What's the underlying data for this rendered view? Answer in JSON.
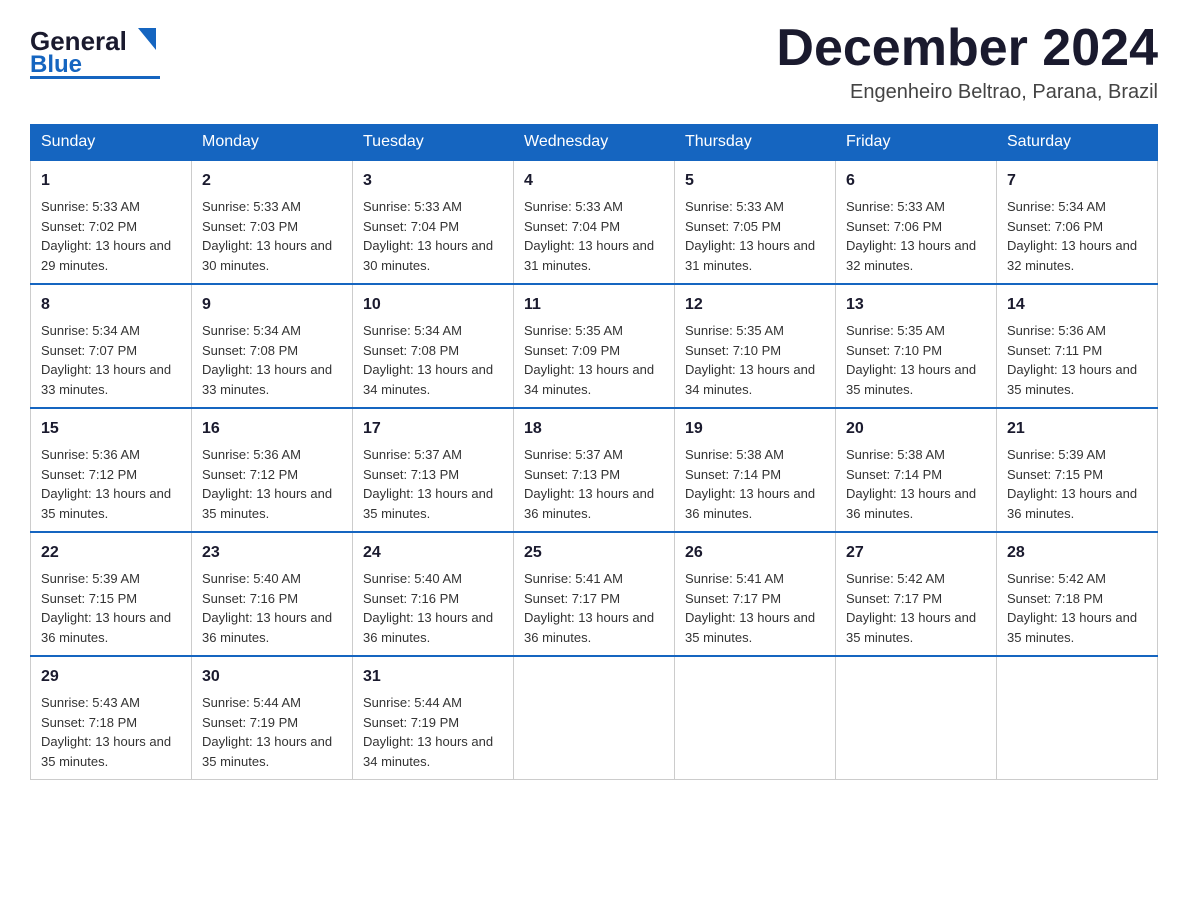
{
  "header": {
    "logo": {
      "line1": "General",
      "triangle": "▶",
      "line2": "Blue"
    },
    "title": "December 2024",
    "location": "Engenheiro Beltrao, Parana, Brazil"
  },
  "calendar": {
    "weekdays": [
      "Sunday",
      "Monday",
      "Tuesday",
      "Wednesday",
      "Thursday",
      "Friday",
      "Saturday"
    ],
    "weeks": [
      [
        {
          "day": "1",
          "sunrise": "5:33 AM",
          "sunset": "7:02 PM",
          "daylight": "13 hours and 29 minutes."
        },
        {
          "day": "2",
          "sunrise": "5:33 AM",
          "sunset": "7:03 PM",
          "daylight": "13 hours and 30 minutes."
        },
        {
          "day": "3",
          "sunrise": "5:33 AM",
          "sunset": "7:04 PM",
          "daylight": "13 hours and 30 minutes."
        },
        {
          "day": "4",
          "sunrise": "5:33 AM",
          "sunset": "7:04 PM",
          "daylight": "13 hours and 31 minutes."
        },
        {
          "day": "5",
          "sunrise": "5:33 AM",
          "sunset": "7:05 PM",
          "daylight": "13 hours and 31 minutes."
        },
        {
          "day": "6",
          "sunrise": "5:33 AM",
          "sunset": "7:06 PM",
          "daylight": "13 hours and 32 minutes."
        },
        {
          "day": "7",
          "sunrise": "5:34 AM",
          "sunset": "7:06 PM",
          "daylight": "13 hours and 32 minutes."
        }
      ],
      [
        {
          "day": "8",
          "sunrise": "5:34 AM",
          "sunset": "7:07 PM",
          "daylight": "13 hours and 33 minutes."
        },
        {
          "day": "9",
          "sunrise": "5:34 AM",
          "sunset": "7:08 PM",
          "daylight": "13 hours and 33 minutes."
        },
        {
          "day": "10",
          "sunrise": "5:34 AM",
          "sunset": "7:08 PM",
          "daylight": "13 hours and 34 minutes."
        },
        {
          "day": "11",
          "sunrise": "5:35 AM",
          "sunset": "7:09 PM",
          "daylight": "13 hours and 34 minutes."
        },
        {
          "day": "12",
          "sunrise": "5:35 AM",
          "sunset": "7:10 PM",
          "daylight": "13 hours and 34 minutes."
        },
        {
          "day": "13",
          "sunrise": "5:35 AM",
          "sunset": "7:10 PM",
          "daylight": "13 hours and 35 minutes."
        },
        {
          "day": "14",
          "sunrise": "5:36 AM",
          "sunset": "7:11 PM",
          "daylight": "13 hours and 35 minutes."
        }
      ],
      [
        {
          "day": "15",
          "sunrise": "5:36 AM",
          "sunset": "7:12 PM",
          "daylight": "13 hours and 35 minutes."
        },
        {
          "day": "16",
          "sunrise": "5:36 AM",
          "sunset": "7:12 PM",
          "daylight": "13 hours and 35 minutes."
        },
        {
          "day": "17",
          "sunrise": "5:37 AM",
          "sunset": "7:13 PM",
          "daylight": "13 hours and 35 minutes."
        },
        {
          "day": "18",
          "sunrise": "5:37 AM",
          "sunset": "7:13 PM",
          "daylight": "13 hours and 36 minutes."
        },
        {
          "day": "19",
          "sunrise": "5:38 AM",
          "sunset": "7:14 PM",
          "daylight": "13 hours and 36 minutes."
        },
        {
          "day": "20",
          "sunrise": "5:38 AM",
          "sunset": "7:14 PM",
          "daylight": "13 hours and 36 minutes."
        },
        {
          "day": "21",
          "sunrise": "5:39 AM",
          "sunset": "7:15 PM",
          "daylight": "13 hours and 36 minutes."
        }
      ],
      [
        {
          "day": "22",
          "sunrise": "5:39 AM",
          "sunset": "7:15 PM",
          "daylight": "13 hours and 36 minutes."
        },
        {
          "day": "23",
          "sunrise": "5:40 AM",
          "sunset": "7:16 PM",
          "daylight": "13 hours and 36 minutes."
        },
        {
          "day": "24",
          "sunrise": "5:40 AM",
          "sunset": "7:16 PM",
          "daylight": "13 hours and 36 minutes."
        },
        {
          "day": "25",
          "sunrise": "5:41 AM",
          "sunset": "7:17 PM",
          "daylight": "13 hours and 36 minutes."
        },
        {
          "day": "26",
          "sunrise": "5:41 AM",
          "sunset": "7:17 PM",
          "daylight": "13 hours and 35 minutes."
        },
        {
          "day": "27",
          "sunrise": "5:42 AM",
          "sunset": "7:17 PM",
          "daylight": "13 hours and 35 minutes."
        },
        {
          "day": "28",
          "sunrise": "5:42 AM",
          "sunset": "7:18 PM",
          "daylight": "13 hours and 35 minutes."
        }
      ],
      [
        {
          "day": "29",
          "sunrise": "5:43 AM",
          "sunset": "7:18 PM",
          "daylight": "13 hours and 35 minutes."
        },
        {
          "day": "30",
          "sunrise": "5:44 AM",
          "sunset": "7:19 PM",
          "daylight": "13 hours and 35 minutes."
        },
        {
          "day": "31",
          "sunrise": "5:44 AM",
          "sunset": "7:19 PM",
          "daylight": "13 hours and 34 minutes."
        },
        null,
        null,
        null,
        null
      ]
    ]
  },
  "labels": {
    "sunrise": "Sunrise:",
    "sunset": "Sunset:",
    "daylight": "Daylight:"
  }
}
